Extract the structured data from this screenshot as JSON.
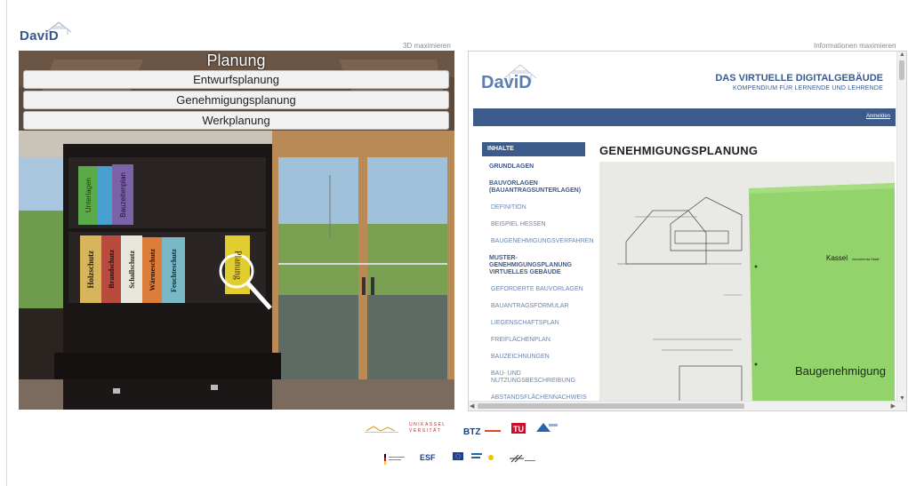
{
  "header": {
    "logo_text": "DaviD"
  },
  "viewport": {
    "maximize_label": "3D maximieren",
    "menu": {
      "title": "Planung",
      "buttons": [
        "Entwurfsplanung",
        "Genehmigungsplanung",
        "Werkplanung"
      ]
    },
    "books_top": [
      "Unterlagen",
      "Bauzeitenplan"
    ],
    "books_bottom": [
      "Holzschutz",
      "Brandschutz",
      "Schallschutz",
      "Wärmeschutz",
      "Feuchteschutz"
    ],
    "book_highlight": "Planung"
  },
  "info": {
    "maximize_label": "Informationen maximieren",
    "site": {
      "logo": "DaviD",
      "title": "DAS VIRTUELLE DIGITALGEBÄUDE",
      "subtitle": "KOMPENDIUM FÜR LERNENDE UND LEHRENDE",
      "login": "Anmelden"
    },
    "sidebar": {
      "heading": "INHALTE",
      "items": [
        {
          "label": "GRUNDLAGEN",
          "style": "bold"
        },
        {
          "label": "BAUVORLAGEN (BAUANTRAGSUNTERLAGEN)",
          "style": "bold"
        },
        {
          "label": "DEFINITION",
          "style": "sub"
        },
        {
          "label": "BEISPIEL HESSEN",
          "style": "sub"
        },
        {
          "label": "BAUGENEHMIGUNGSVERFAHREN",
          "style": "sub"
        },
        {
          "label": "MUSTER-GENEHMIGUNGSPLANUNG VIRTUELLES GEBÄUDE",
          "style": "bold"
        },
        {
          "label": "GEFORDERTE BAUVORLAGEN",
          "style": "sub"
        },
        {
          "label": "BAUANTRAGSFORMULAR",
          "style": "sub"
        },
        {
          "label": "LIEGENSCHAFTSPLAN",
          "style": "sub"
        },
        {
          "label": "FREIFLÄCHENPLAN",
          "style": "sub"
        },
        {
          "label": "BAUZEICHNUNGEN",
          "style": "sub"
        },
        {
          "label": "BAU- UND NUTZUNGSBESCHREIBUNG",
          "style": "sub"
        },
        {
          "label": "ABSTANDSFLÄCHENNACHWEIS",
          "style": "sub"
        }
      ]
    },
    "content": {
      "title": "GENEHMIGUNGSPLANUNG",
      "folder_city": "Kassel",
      "folder_small": "documenta Stadt",
      "folder_label": "Baugenehmigung"
    }
  },
  "footer": {
    "logos_row1": [
      "UNIKASSEL VERSITÄT",
      "BTZ"
    ],
    "logos_row2": [
      "ESF"
    ]
  }
}
